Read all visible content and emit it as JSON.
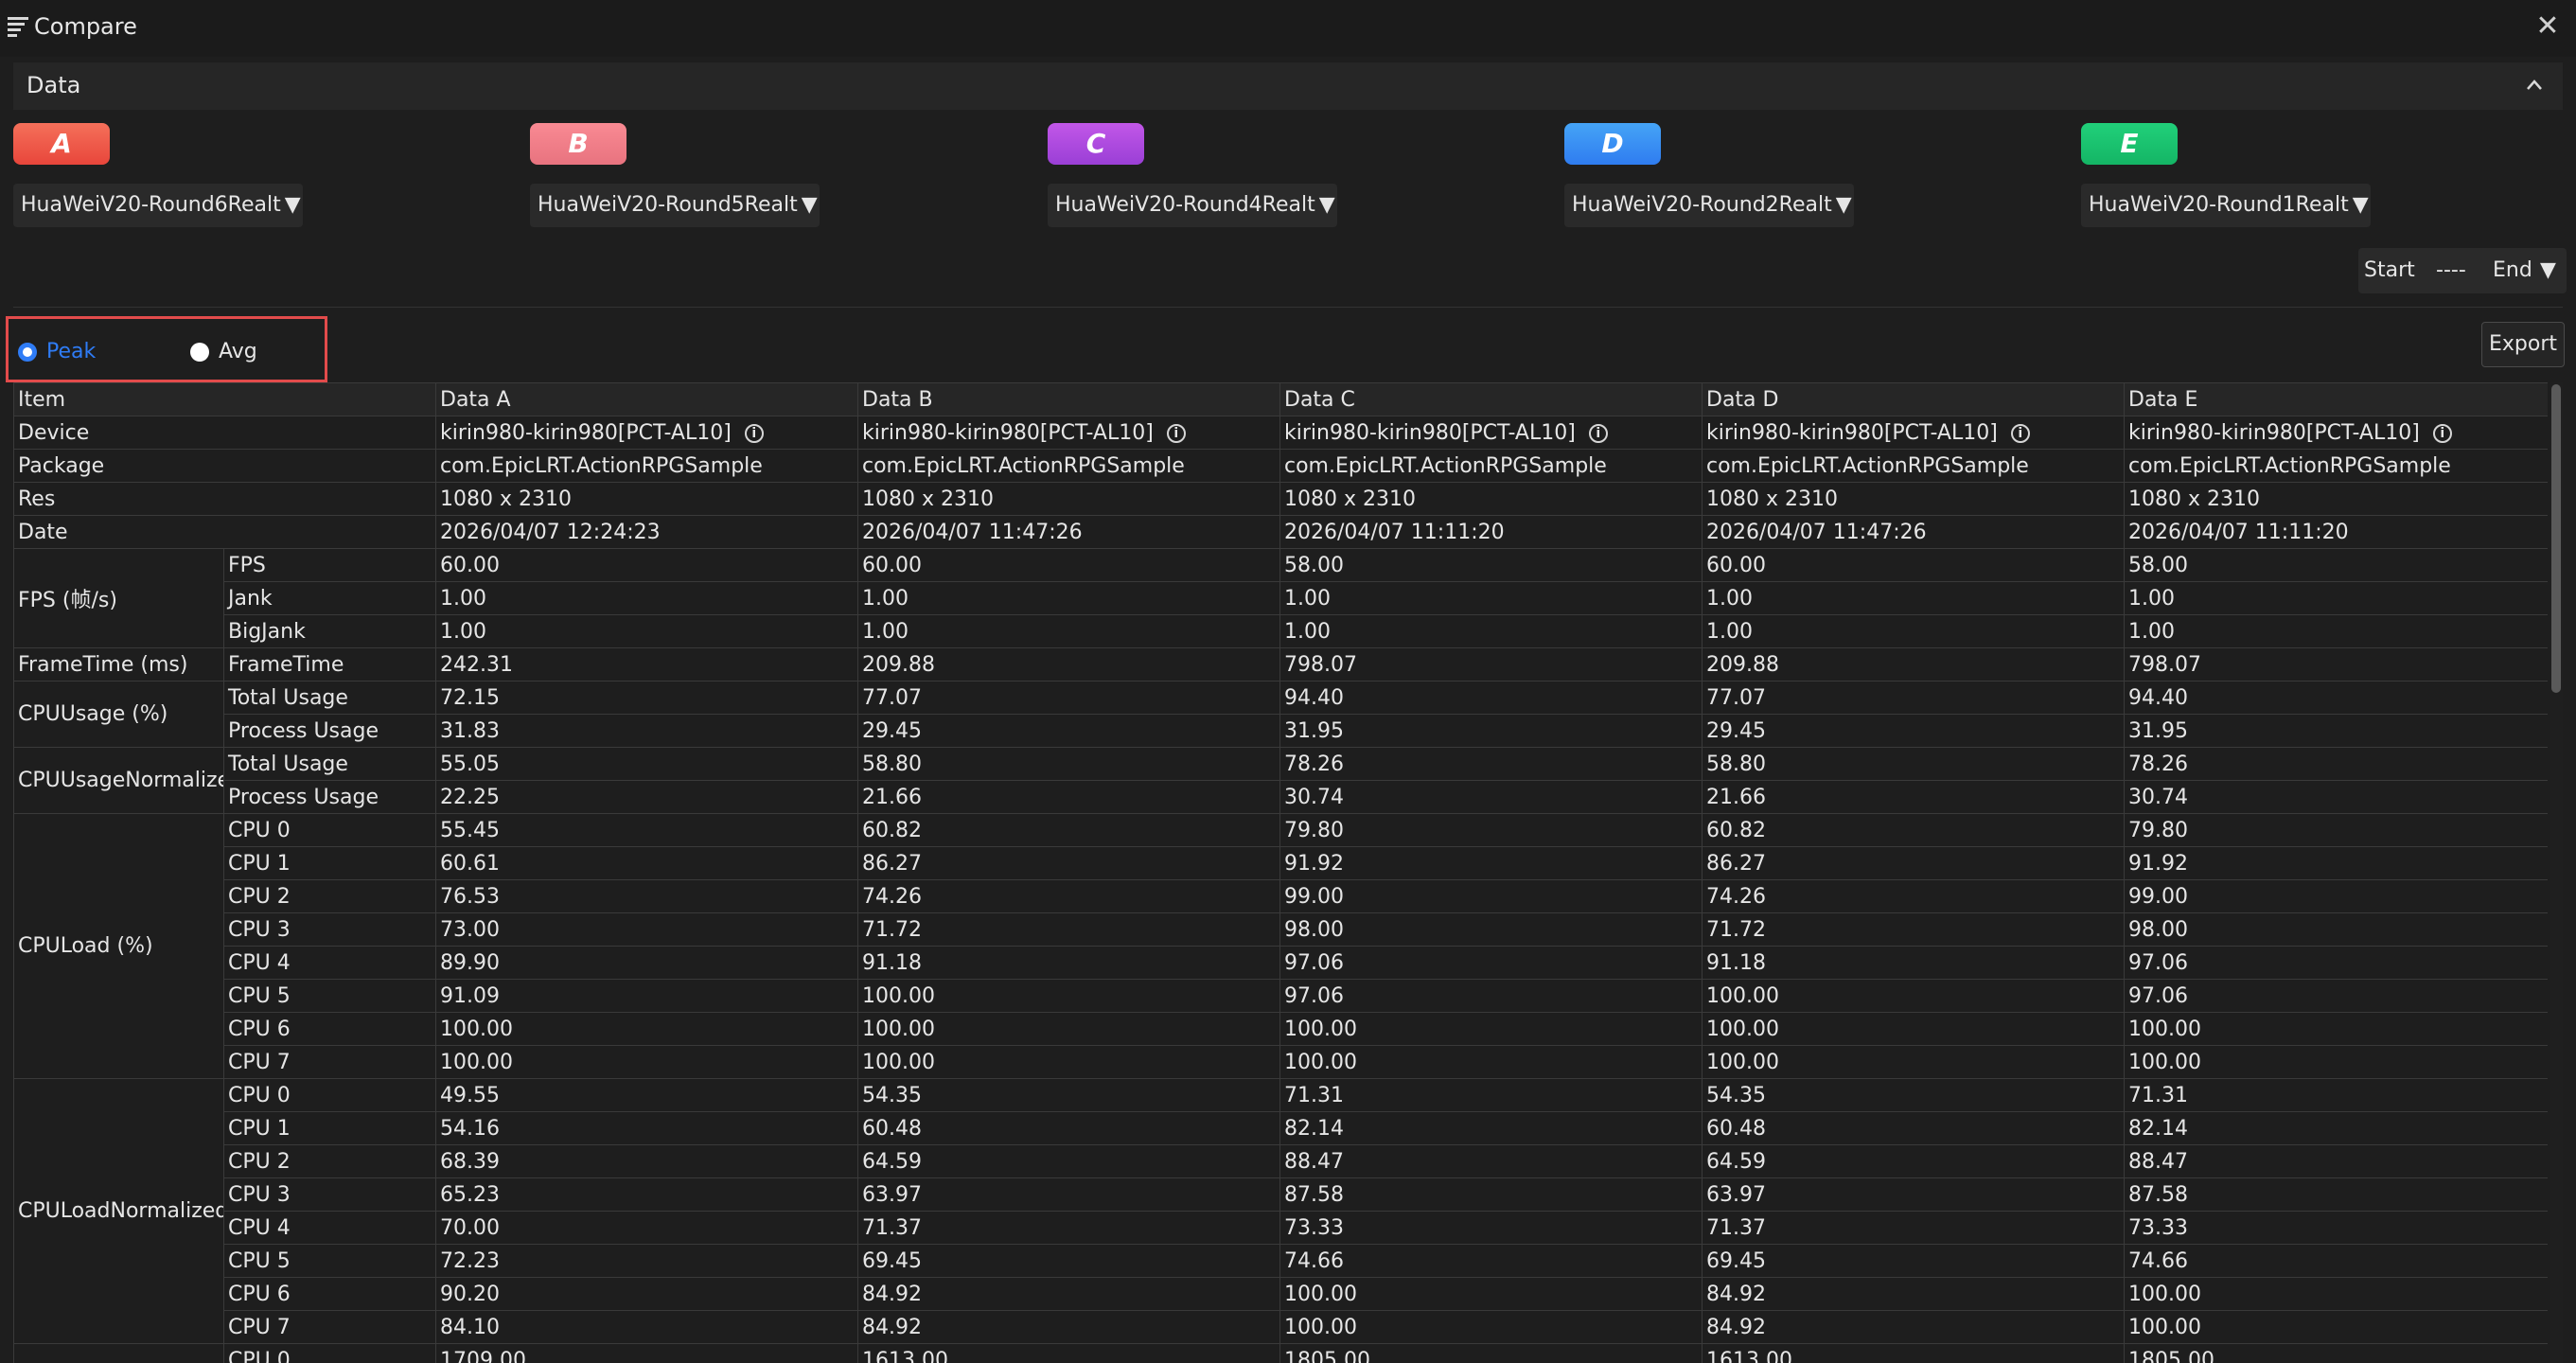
{
  "window": {
    "title": "Compare"
  },
  "section": {
    "title": "Data"
  },
  "badges": [
    {
      "letter": "A",
      "colors": [
        "#f5705a",
        "#e8463b"
      ]
    },
    {
      "letter": "B",
      "colors": [
        "#f98a93",
        "#e8737f"
      ]
    },
    {
      "letter": "C",
      "colors": [
        "#c257e8",
        "#9a3fd6"
      ]
    },
    {
      "letter": "D",
      "colors": [
        "#45a4f6",
        "#2f7cf0"
      ]
    },
    {
      "letter": "E",
      "colors": [
        "#21d07a",
        "#14b565"
      ]
    }
  ],
  "sources": [
    "HuaWeiV20-Round6Realt",
    "HuaWeiV20-Round5Realt",
    "HuaWeiV20-Round4Realt",
    "HuaWeiV20-Round2Realt",
    "HuaWeiV20-Round1Realt"
  ],
  "range": {
    "start": "Start",
    "dash": "----",
    "end": "End"
  },
  "mode": {
    "peak": "Peak",
    "avg": "Avg",
    "selected": "peak"
  },
  "export_label": "Export",
  "table": {
    "columns": [
      "Item",
      "Data A",
      "Data B",
      "Data C",
      "Data D",
      "Data E"
    ],
    "info_rows": [
      {
        "label": "Device",
        "values": [
          "kirin980-kirin980[PCT-AL10]",
          "kirin980-kirin980[PCT-AL10]",
          "kirin980-kirin980[PCT-AL10]",
          "kirin980-kirin980[PCT-AL10]",
          "kirin980-kirin980[PCT-AL10]"
        ],
        "info_icon": true
      },
      {
        "label": "Package",
        "values": [
          "com.EpicLRT.ActionRPGSample",
          "com.EpicLRT.ActionRPGSample",
          "com.EpicLRT.ActionRPGSample",
          "com.EpicLRT.ActionRPGSample",
          "com.EpicLRT.ActionRPGSample"
        ]
      },
      {
        "label": "Res",
        "values": [
          "1080 x 2310",
          "1080 x 2310",
          "1080 x 2310",
          "1080 x 2310",
          "1080 x 2310"
        ]
      },
      {
        "label": "Date",
        "values": [
          "2026/04/07 12:24:23",
          "2026/04/07 11:47:26",
          "2026/04/07 11:11:20",
          "2026/04/07 11:47:26",
          "2026/04/07 11:11:20"
        ]
      }
    ],
    "groups": [
      {
        "name": "FPS (帧/s)",
        "rows": [
          {
            "sub": "FPS",
            "values": [
              "60.00",
              "60.00",
              "58.00",
              "60.00",
              "58.00"
            ]
          },
          {
            "sub": "Jank",
            "values": [
              "1.00",
              "1.00",
              "1.00",
              "1.00",
              "1.00"
            ]
          },
          {
            "sub": "BigJank",
            "values": [
              "1.00",
              "1.00",
              "1.00",
              "1.00",
              "1.00"
            ]
          }
        ]
      },
      {
        "name": "FrameTime (ms)",
        "rows": [
          {
            "sub": "FrameTime",
            "values": [
              "242.31",
              "209.88",
              "798.07",
              "209.88",
              "798.07"
            ]
          }
        ]
      },
      {
        "name": "CPUUsage (%)",
        "rows": [
          {
            "sub": "Total Usage",
            "values": [
              "72.15",
              "77.07",
              "94.40",
              "77.07",
              "94.40"
            ]
          },
          {
            "sub": "Process Usage",
            "values": [
              "31.83",
              "29.45",
              "31.95",
              "29.45",
              "31.95"
            ]
          }
        ]
      },
      {
        "name": "CPUUsageNormalized",
        "rows": [
          {
            "sub": "Total Usage",
            "values": [
              "55.05",
              "58.80",
              "78.26",
              "58.80",
              "78.26"
            ]
          },
          {
            "sub": "Process Usage",
            "values": [
              "22.25",
              "21.66",
              "30.74",
              "21.66",
              "30.74"
            ]
          }
        ]
      },
      {
        "name": "CPULoad (%)",
        "rows": [
          {
            "sub": "CPU 0",
            "values": [
              "55.45",
              "60.82",
              "79.80",
              "60.82",
              "79.80"
            ]
          },
          {
            "sub": "CPU 1",
            "values": [
              "60.61",
              "86.27",
              "91.92",
              "86.27",
              "91.92"
            ]
          },
          {
            "sub": "CPU 2",
            "values": [
              "76.53",
              "74.26",
              "99.00",
              "74.26",
              "99.00"
            ]
          },
          {
            "sub": "CPU 3",
            "values": [
              "73.00",
              "71.72",
              "98.00",
              "71.72",
              "98.00"
            ]
          },
          {
            "sub": "CPU 4",
            "values": [
              "89.90",
              "91.18",
              "97.06",
              "91.18",
              "97.06"
            ]
          },
          {
            "sub": "CPU 5",
            "values": [
              "91.09",
              "100.00",
              "97.06",
              "100.00",
              "97.06"
            ]
          },
          {
            "sub": "CPU 6",
            "values": [
              "100.00",
              "100.00",
              "100.00",
              "100.00",
              "100.00"
            ]
          },
          {
            "sub": "CPU 7",
            "values": [
              "100.00",
              "100.00",
              "100.00",
              "100.00",
              "100.00"
            ]
          }
        ]
      },
      {
        "name": "CPULoadNormalized",
        "rows": [
          {
            "sub": "CPU 0",
            "values": [
              "49.55",
              "54.35",
              "71.31",
              "54.35",
              "71.31"
            ]
          },
          {
            "sub": "CPU 1",
            "values": [
              "54.16",
              "60.48",
              "82.14",
              "60.48",
              "82.14"
            ]
          },
          {
            "sub": "CPU 2",
            "values": [
              "68.39",
              "64.59",
              "88.47",
              "64.59",
              "88.47"
            ]
          },
          {
            "sub": "CPU 3",
            "values": [
              "65.23",
              "63.97",
              "87.58",
              "63.97",
              "87.58"
            ]
          },
          {
            "sub": "CPU 4",
            "values": [
              "70.00",
              "71.37",
              "73.33",
              "71.37",
              "73.33"
            ]
          },
          {
            "sub": "CPU 5",
            "values": [
              "72.23",
              "69.45",
              "74.66",
              "69.45",
              "74.66"
            ]
          },
          {
            "sub": "CPU 6",
            "values": [
              "90.20",
              "84.92",
              "100.00",
              "84.92",
              "100.00"
            ]
          },
          {
            "sub": "CPU 7",
            "values": [
              "84.10",
              "84.92",
              "100.00",
              "84.92",
              "100.00"
            ]
          }
        ]
      },
      {
        "name": "",
        "rows": [
          {
            "sub": "CPU 0",
            "values": [
              "1709.00",
              "1613.00",
              "1805.00",
              "1613.00",
              "1805.00"
            ]
          }
        ]
      }
    ]
  }
}
